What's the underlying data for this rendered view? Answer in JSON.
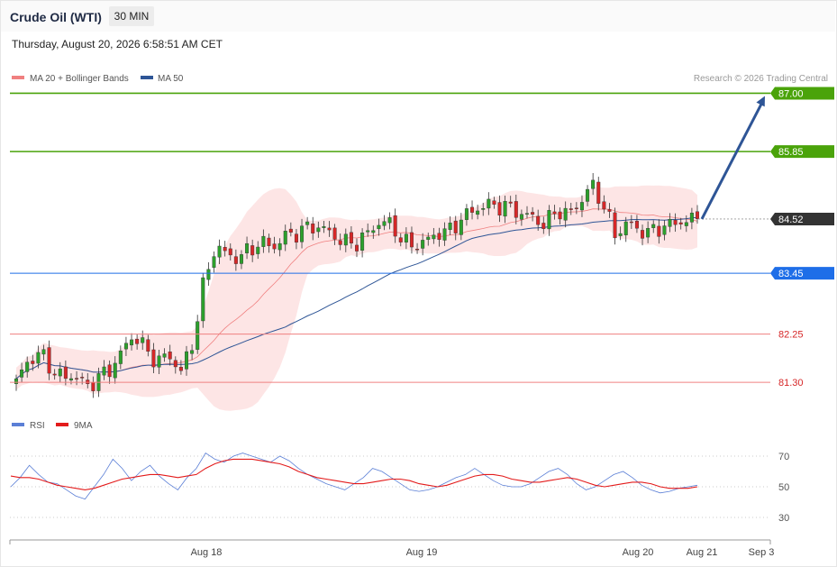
{
  "header": {
    "title": "Crude Oil (WTI)",
    "interval": "30 MIN",
    "timestamp": "Thursday, August 20, 2026 6:58:51 AM CET"
  },
  "legend_top": {
    "items": [
      {
        "label": "MA 20 + Bollinger Bands",
        "color": "#f08080"
      },
      {
        "label": "MA 50",
        "color": "#2e5596"
      }
    ],
    "credit": "Research © 2026 Trading Central"
  },
  "legend_bottom": {
    "items": [
      {
        "label": "RSI",
        "color": "#5b7fd6"
      },
      {
        "label": "9MA",
        "color": "#e31b1b"
      }
    ]
  },
  "colors": {
    "up_candle": "#2ca02c",
    "down_candle": "#d62728",
    "resistance": "#4aa30a",
    "support": "#1e6ee8",
    "minor_level": "#f08080",
    "current": "#333333",
    "arrow": "#2e5596",
    "band_fill": "#fde2e2"
  },
  "chart_data": [
    {
      "type": "candlestick",
      "title": "",
      "y_range": [
        80.75,
        87.15
      ],
      "x_ticks": [
        "Aug 18",
        "Aug 19",
        "Aug 20",
        "Aug 21",
        "Sep 3"
      ],
      "levels": [
        {
          "value": 87.0,
          "label": "87.00",
          "kind": "resistance"
        },
        {
          "value": 85.85,
          "label": "85.85",
          "kind": "resistance"
        },
        {
          "value": 84.52,
          "label": "84.52",
          "kind": "current"
        },
        {
          "value": 83.45,
          "label": "83.45",
          "kind": "support"
        },
        {
          "value": 82.25,
          "label": "82.25",
          "kind": "minor"
        },
        {
          "value": 81.3,
          "label": "81.30",
          "kind": "minor"
        }
      ],
      "projection": {
        "from": 84.52,
        "to": 87.0,
        "direction": "up"
      },
      "series": [
        {
          "name": "MA 20 + Bollinger Bands",
          "kind": "bollinger"
        },
        {
          "name": "MA 50",
          "kind": "ma"
        }
      ],
      "close_path": [
        81.32,
        81.7,
        81.9,
        81.55,
        81.38,
        81.45,
        81.2,
        81.4,
        81.55,
        81.9,
        82.25,
        81.95,
        81.7,
        81.85,
        81.5,
        82.05,
        83.3,
        84.0,
        83.8,
        83.75,
        83.95,
        84.05,
        83.98,
        84.2,
        84.25,
        84.38,
        84.35,
        84.2,
        84.05,
        84.05,
        84.25,
        84.48,
        84.4,
        84.05,
        84.0,
        84.1,
        84.25,
        84.3,
        84.55,
        84.7,
        84.8,
        84.78,
        84.75,
        84.62,
        84.55,
        84.4,
        84.7,
        84.6,
        84.85,
        85.2,
        84.8,
        84.2,
        84.45,
        84.3,
        84.25,
        84.38,
        84.42,
        84.5,
        84.52
      ]
    },
    {
      "type": "line",
      "title": "",
      "y_ticks": [
        70,
        50,
        30
      ],
      "series": [
        {
          "name": "RSI",
          "values": [
            50,
            56,
            64,
            58,
            53,
            52,
            48,
            44,
            42,
            50,
            58,
            68,
            62,
            54,
            60,
            64,
            57,
            52,
            48,
            56,
            62,
            72,
            68,
            66,
            70,
            72,
            70,
            68,
            66,
            70,
            67,
            62,
            58,
            55,
            52,
            50,
            48,
            52,
            56,
            62,
            60,
            56,
            52,
            48,
            47,
            48,
            50,
            53,
            56,
            58,
            62,
            58,
            54,
            51,
            50,
            50,
            52,
            56,
            60,
            62,
            58,
            52,
            48,
            50,
            54,
            58,
            60,
            56,
            51,
            48,
            46,
            47,
            49,
            50,
            51
          ]
        },
        {
          "name": "9MA",
          "values": [
            57,
            56,
            56,
            55,
            53,
            51,
            50,
            49,
            48,
            49,
            51,
            53,
            55,
            56,
            57,
            58,
            58,
            57,
            56,
            57,
            58,
            62,
            65,
            67,
            68,
            68,
            68,
            67,
            66,
            65,
            63,
            60,
            58,
            56,
            55,
            54,
            53,
            52,
            52,
            53,
            54,
            55,
            55,
            54,
            52,
            51,
            50,
            51,
            53,
            55,
            57,
            58,
            58,
            57,
            55,
            54,
            53,
            53,
            54,
            55,
            56,
            55,
            53,
            51,
            50,
            51,
            52,
            53,
            53,
            52,
            50,
            49,
            49,
            49,
            50
          ]
        }
      ]
    }
  ]
}
